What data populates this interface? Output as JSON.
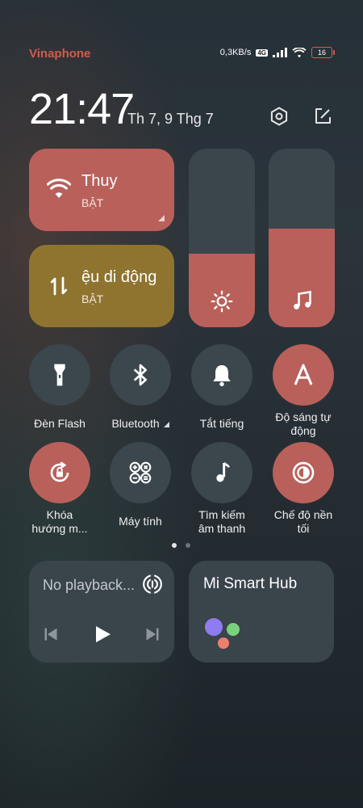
{
  "status_bar": {
    "carrier": "Vinaphone",
    "net_speed": "0,3KB/s",
    "lte_badge": "4G",
    "battery": "16"
  },
  "header": {
    "time": "21:47",
    "date": "Th 7, 9 Thg 7"
  },
  "tiles": {
    "wifi": {
      "title": "Thuy",
      "state": "BẬT"
    },
    "mobile_data": {
      "title": "ệu di động",
      "state": "BẬT"
    }
  },
  "sliders": {
    "brightness_level": 0.41,
    "volume_level": 0.55
  },
  "toggles": [
    {
      "label": "Đèn Flash",
      "on": false
    },
    {
      "label": "Bluetooth",
      "on": false
    },
    {
      "label": "Tắt tiếng",
      "on": false
    },
    {
      "label": "Độ sáng tự động",
      "on": true
    },
    {
      "label": "Khóa hướng m...",
      "on": true
    },
    {
      "label": "Máy tính",
      "on": false
    },
    {
      "label": "Tìm kiếm âm thanh",
      "on": false
    },
    {
      "label": "Chế độ nền tối",
      "on": true
    }
  ],
  "toggle_labels": {
    "flash": "Đèn Flash",
    "bluetooth": "Bluetooth",
    "mute": "Tắt tiếng",
    "auto_brightness_l1": "Độ sáng tự",
    "auto_brightness_l2": "động",
    "rotation_l1": "Khóa",
    "rotation_l2": "hướng m...",
    "calculator": "Máy tính",
    "sound_search_l1": "Tìm kiếm",
    "sound_search_l2": "âm thanh",
    "dark_mode_l1": "Chế độ nền",
    "dark_mode_l2": "tối"
  },
  "pager": {
    "current": 1,
    "total": 2
  },
  "media": {
    "text": "No playback..."
  },
  "hub": {
    "title": "Mi Smart Hub"
  },
  "colors": {
    "accent": "#b9605a",
    "data_tile": "#8f7430",
    "inactive": "#3c464d",
    "carrier": "#d65a4c"
  }
}
